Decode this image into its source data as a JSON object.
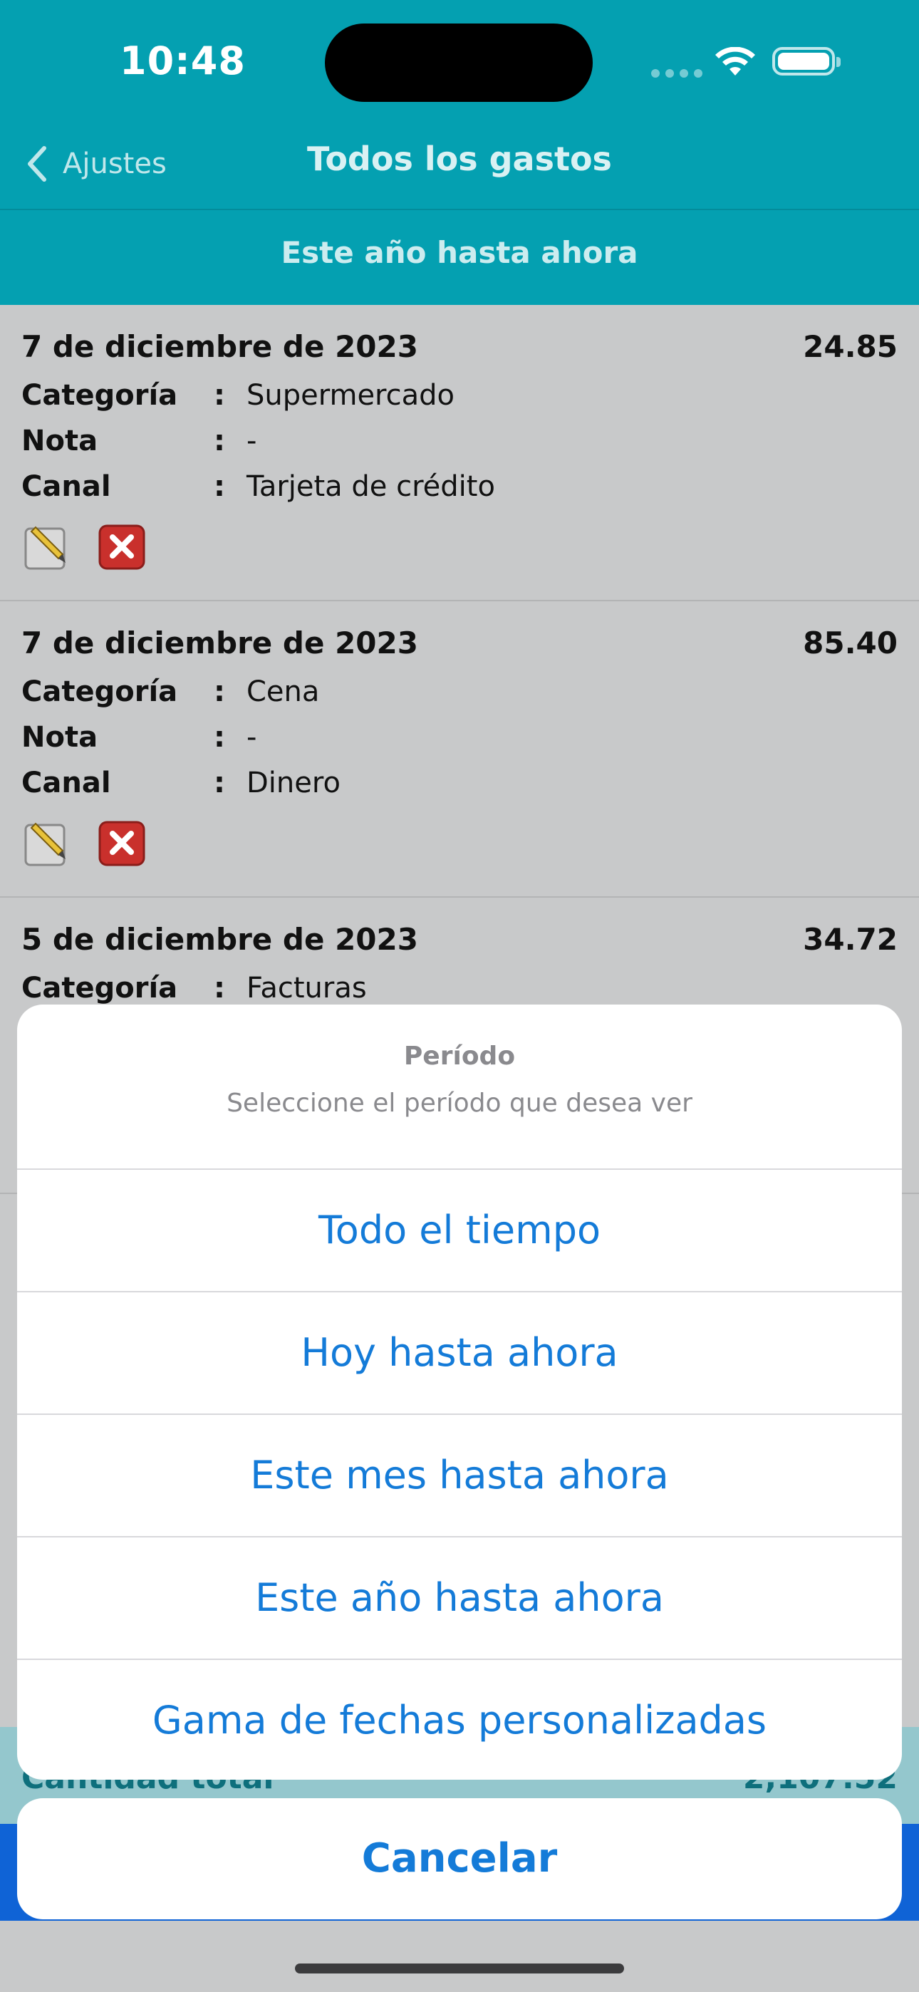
{
  "status_bar": {
    "time": "10:48"
  },
  "nav": {
    "back_label": "Ajustes",
    "title": "Todos los gastos"
  },
  "period": {
    "label": "Este año hasta ahora"
  },
  "field_labels": {
    "category": "Categoría",
    "note": "Nota",
    "channel": "Canal",
    "separator": ":"
  },
  "expenses": [
    {
      "date": "7 de diciembre de 2023",
      "amount": "24.85",
      "category": "Supermercado",
      "note": "-",
      "channel": "Tarjeta de crédito"
    },
    {
      "date": "7 de diciembre de 2023",
      "amount": "85.40",
      "category": "Cena",
      "note": "-",
      "channel": "Dinero"
    },
    {
      "date": "5 de diciembre de 2023",
      "amount": "34.72",
      "category": "Facturas"
    }
  ],
  "total": {
    "label": "Cantidad total",
    "value": "2,107.52"
  },
  "action_sheet": {
    "title": "Período",
    "message": "Seleccione el período que desea ver",
    "options": [
      "Todo el tiempo",
      "Hoy hasta ahora",
      "Este mes hasta ahora",
      "Este año hasta ahora",
      "Gama de fechas personalizadas"
    ],
    "cancel": "Cancelar"
  },
  "colors": {
    "header": "#04a0b1",
    "accent": "#147bd8",
    "list_bg": "#c8c9ca"
  }
}
